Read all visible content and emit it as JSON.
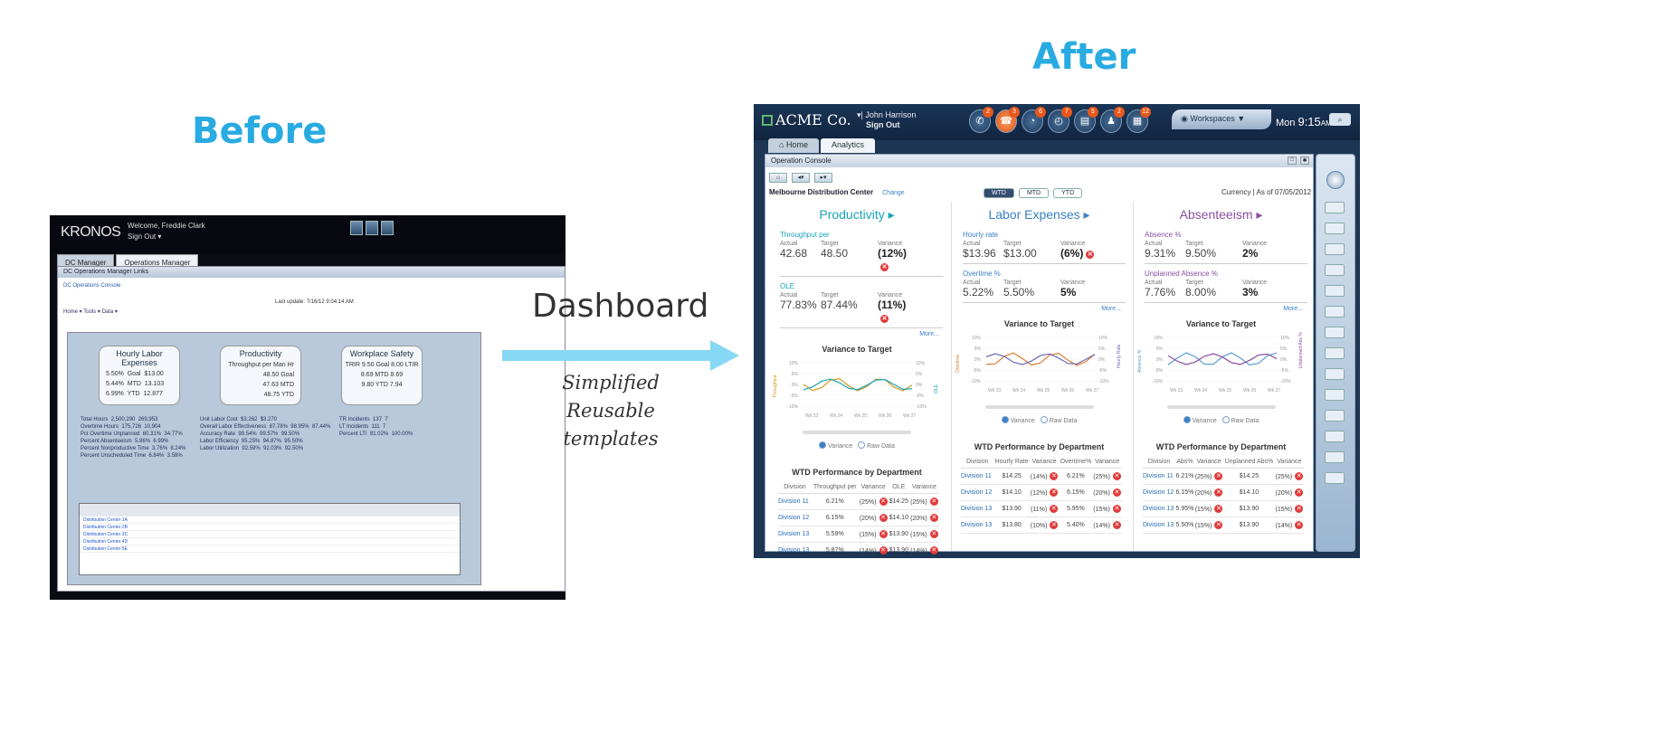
{
  "labels": {
    "before": "Before",
    "after": "After",
    "dashboard": "Dashboard",
    "simplified": "Simplified",
    "reusable": "Reusable templates"
  },
  "before": {
    "logo": "KRONOS",
    "welcome": "Welcome, Freddie Clark",
    "signout": "Sign Out ▾",
    "tabs": [
      "DC Manager",
      "Operations Manager"
    ],
    "window_title": "DC Operations Manager Links",
    "breadcrumb": "DC Operations Console",
    "menus": "Home ▾  Tools ▾  Data ▾",
    "last_update": "Last update: 7/16/12 9:04:14 AM",
    "panels": {
      "labor": "Hourly Labor Expenses",
      "productivity": "Productivity",
      "safety": "Workplace Safety"
    },
    "labor_vals": "5.50%  Goal  $13.00\n5.44%  MTD  13.103\n6.99%  YTD  12.877",
    "prod_vals": "Throughput per Man Hr\n48.50 Goal\n47.63 MTD\n48.75 YTD",
    "safety_vals": "TRIR 9.50 Goal 8.00 LTIR\n8.69 MTD 8.69\n9.80 YTD 7.94",
    "stats_left": "Total Hours  2,500,290  269,953\nOvertime Hours  175,726  10,904\nPct Overtime Unplanned  60.31%  34.77%\nPercent Absenteeism  5.86%  6.99%\nPercent Nonproductive Time  3.76%  8.24%\nPercent Unscheduled Time  6.84%  3.58%",
    "stats_mid": "Unit Labor Cost  $3.262  $3.270\nOverall Labor Effectiveness  87.78%  98.95%  87.44%\nAccuracy Rate  99.54%  99.57%  99.50%\nLabor Efficiency  95.25%  94.87%  95.50%\nLabor Utilization  92.59%  92.03%  92.50%",
    "stats_right": "TR Incidents  137  7\nLT Incidents  111  7\nPercent LTI  81.02%  100.00%",
    "rows": [
      "Distribution Center 1A",
      "Distribution Center 2B",
      "Distribution Center 3C",
      "Distribution Center 4D",
      "Distribution Center 5E"
    ]
  },
  "after": {
    "company": "ACME Co.",
    "user": "John Harrison",
    "signout": "Sign Out",
    "icons": [
      {
        "n": "megaphone-icon",
        "b": "2",
        "g": "✆"
      },
      {
        "n": "alert-icon",
        "b": "3",
        "g": "☎",
        "on": true
      },
      {
        "n": "stopwatch-icon",
        "b": "6",
        "g": "◔"
      },
      {
        "n": "gauge-icon",
        "b": "7",
        "g": "◴"
      },
      {
        "n": "report-icon",
        "b": "5",
        "g": "▤"
      },
      {
        "n": "people-icon",
        "b": "2",
        "g": "♟"
      },
      {
        "n": "keyboard-icon",
        "b": "12",
        "g": "▦"
      }
    ],
    "workspaces": "Workspaces",
    "day": "Mon",
    "time": "9:15",
    "ampm": "AM",
    "tabs": [
      "Home",
      "Analytics"
    ],
    "console_title": "Operation Console",
    "location": "Melbourne Distribution Center",
    "change": "Change",
    "periods": [
      "WTD",
      "MTD",
      "YTD"
    ],
    "currency": "Currency   |  As of 07/05/2012",
    "columns": [
      {
        "title": "Productivity ▸",
        "color": "#1aa3b8",
        "m1": {
          "name": "Throughput per",
          "actual": "42.68",
          "target": "48.50",
          "variance": "(12%)"
        },
        "m2": {
          "name": "OLE",
          "actual": "77.83%",
          "target": "87.44%",
          "variance": "(11%)"
        },
        "y_left": "Throughput",
        "y_right": "OLE",
        "c1": "#d69a1c",
        "c2": "#1aa3b8",
        "th": [
          "Division",
          "Throughput per",
          "Variance",
          "OLE",
          "Variance"
        ],
        "rows": [
          [
            "Division 11",
            "6.21%",
            "(25%)",
            "$14.25",
            "(25%)"
          ],
          [
            "Division 12",
            "6.15%",
            "(20%)",
            "$14.10",
            "(20%)"
          ],
          [
            "Division 13",
            "5.59%",
            "(15%)",
            "$13.90",
            "(15%)"
          ],
          [
            "Division 13",
            "5.87%",
            "(14%)",
            "$13.90",
            "(14%)"
          ]
        ]
      },
      {
        "title": "Labor Expenses ▸",
        "color": "#3a80c6",
        "m1": {
          "name": "Hourly rate",
          "actual": "$13.96",
          "target": "$13.00",
          "variance": "(6%)"
        },
        "m2": {
          "name": "Overtime %",
          "actual": "5.22%",
          "target": "5.50%",
          "variance": "5%"
        },
        "y_left": "Overtime",
        "y_right": "Hourly Rate",
        "c1": "#e07a30",
        "c2": "#6b6bb8",
        "th": [
          "Division",
          "Hourly Rate",
          "Variance",
          "Overtime%",
          "Variance"
        ],
        "rows": [
          [
            "Division 11",
            "$14.25",
            "(14%)",
            "6.21%",
            "(25%)"
          ],
          [
            "Division 12",
            "$14.10",
            "(12%)",
            "6.15%",
            "(20%)"
          ],
          [
            "Division 13",
            "$13.90",
            "(11%)",
            "5.95%",
            "(15%)"
          ],
          [
            "Division 13",
            "$13.80",
            "(10%)",
            "5.40%",
            "(14%)"
          ]
        ]
      },
      {
        "title": "Absenteeism ▸",
        "color": "#8a4fa0",
        "m1": {
          "name": "Absence %",
          "actual": "9.31%",
          "target": "9.50%",
          "variance": "2%"
        },
        "m2": {
          "name": "Unplanned Absence %",
          "actual": "7.76%",
          "target": "8.00%",
          "variance": "3%"
        },
        "y_left": "Absence %",
        "y_right": "Unplanned Abs %",
        "c1": "#5a9bd4",
        "c2": "#8a4fa0",
        "th": [
          "Division",
          "Abs%",
          "Variance",
          "Unplanned Abs%",
          "Variance"
        ],
        "rows": [
          [
            "Division 11",
            "6.21%",
            "(25%)",
            "$14.25",
            "(25%)"
          ],
          [
            "Division 12",
            "6.15%",
            "(20%)",
            "$14.10",
            "(20%)"
          ],
          [
            "Division 13",
            "5.95%",
            "(15%)",
            "$13.90",
            "(15%)"
          ],
          [
            "Division 13",
            "5.50%",
            "(15%)",
            "$13.90",
            "(14%)"
          ]
        ]
      }
    ],
    "actual": "Actual",
    "target": "Target",
    "variance": "Variance",
    "more": "More...",
    "vtt": "Variance to Target",
    "wtd": "WTD Performance by Department",
    "radio_variance": "Variance",
    "radio_raw": "Raw Data",
    "weeks": [
      "Wk 23",
      "Wk 24",
      "Wk 25",
      "Wk 26",
      "Wk 27"
    ],
    "yticks": [
      "10%",
      "5%",
      "0%",
      "-5%",
      "-10%"
    ]
  }
}
